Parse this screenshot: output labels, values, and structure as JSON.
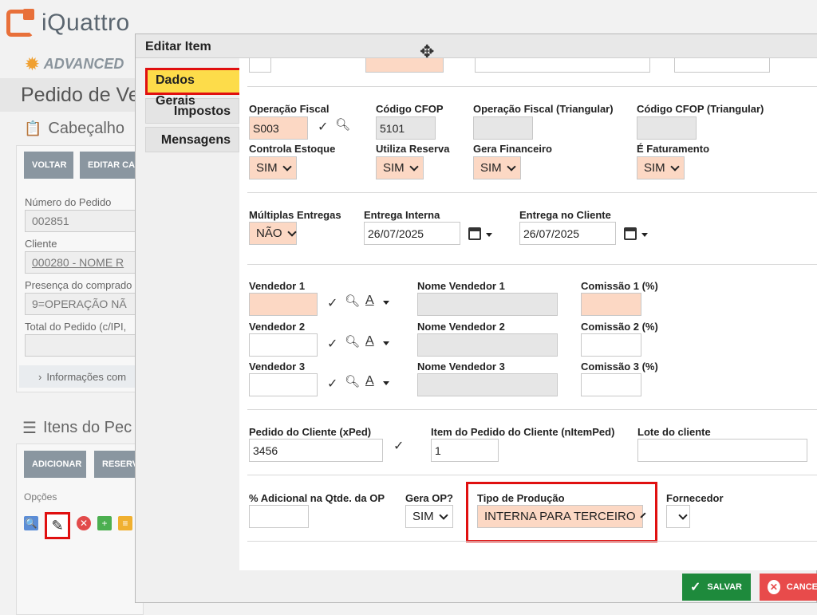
{
  "app": {
    "logo_text": "iQuattro",
    "badge": "ADVANCED",
    "page_title": "Pedido de Ve",
    "section_header": "Cabeçalho",
    "buttons": {
      "voltar": "VOLTAR",
      "editar": "EDITAR CA"
    },
    "fields": [
      {
        "label": "Número do Pedido",
        "value": "002851"
      },
      {
        "label": "Cliente",
        "value": "000280 - NOME R"
      },
      {
        "label": "Presença do comprado",
        "value": "9=OPERAÇÃO NÃ"
      },
      {
        "label": "Total do Pedido (c/IPI,",
        "value": ""
      }
    ],
    "info_link": "Informações com",
    "items_header": "Itens do Pec",
    "items_buttons": {
      "adicionar": "ADICIONAR",
      "reserv": "RESERV"
    },
    "options_label": "Opções"
  },
  "modal": {
    "title": "Editar Item",
    "tabs": [
      {
        "label": "Dados Gerais",
        "active": true
      },
      {
        "label": "Impostos",
        "active": false
      },
      {
        "label": "Mensagens",
        "active": false
      }
    ],
    "row1": {
      "operacao_fiscal": {
        "label": "Operação Fiscal",
        "value": "S003"
      },
      "codigo_cfop": {
        "label": "Código CFOP",
        "value": "5101"
      },
      "operacao_triangular": {
        "label": "Operação Fiscal (Triangular)",
        "value": ""
      },
      "cfop_triangular": {
        "label": "Código CFOP (Triangular)",
        "value": ""
      }
    },
    "row2": {
      "controla_estoque": {
        "label": "Controla Estoque",
        "value": "SIM"
      },
      "utiliza_reserva": {
        "label": "Utiliza Reserva",
        "value": "SIM"
      },
      "gera_financeiro": {
        "label": "Gera Financeiro",
        "value": "SIM"
      },
      "e_faturamento": {
        "label": "É Faturamento",
        "value": "SIM"
      }
    },
    "row3": {
      "multiplas_entregas": {
        "label": "Múltiplas Entregas",
        "value": "NÃO"
      },
      "entrega_interna": {
        "label": "Entrega Interna",
        "value": "26/07/2025"
      },
      "entrega_cliente": {
        "label": "Entrega no Cliente",
        "value": "26/07/2025"
      }
    },
    "vendedores": [
      {
        "label": "Vendedor 1",
        "nome_label": "Nome Vendedor 1",
        "comissao_label": "Comissão 1 (%)",
        "value": "",
        "nome": "",
        "comissao": ""
      },
      {
        "label": "Vendedor 2",
        "nome_label": "Nome Vendedor 2",
        "comissao_label": "Comissão 2 (%)",
        "value": "",
        "nome": "",
        "comissao": ""
      },
      {
        "label": "Vendedor 3",
        "nome_label": "Nome Vendedor 3",
        "comissao_label": "Comissão 3 (%)",
        "value": "",
        "nome": "",
        "comissao": ""
      }
    ],
    "pedido": {
      "pedido_cliente": {
        "label": "Pedido do Cliente (xPed)",
        "value": "3456"
      },
      "item_pedido": {
        "label": "Item do Pedido do Cliente (nItemPed)",
        "value": "1"
      },
      "lote": {
        "label": "Lote do cliente",
        "value": ""
      }
    },
    "producao": {
      "adicional": {
        "label": "% Adicional na Qtde. da OP",
        "value": ""
      },
      "gera_op": {
        "label": "Gera OP?",
        "value": "SIM"
      },
      "tipo_producao": {
        "label": "Tipo de Produção",
        "value": "INTERNA PARA TERCEIRO"
      },
      "fornecedor": {
        "label": "Fornecedor",
        "value": ""
      }
    },
    "footer": {
      "salvar": "SALVAR",
      "cancelar": "CANCE"
    }
  }
}
